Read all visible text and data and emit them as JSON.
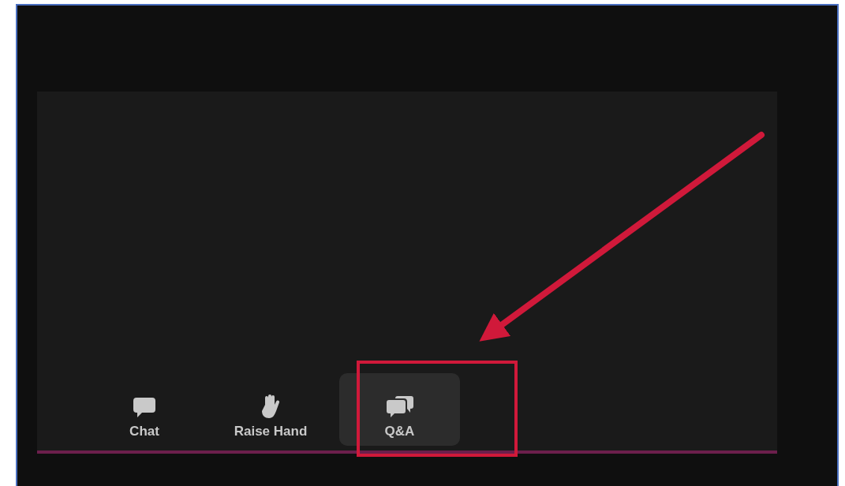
{
  "toolbar": {
    "items": [
      {
        "kind": "chat",
        "label": "Chat",
        "selected": false
      },
      {
        "kind": "hand",
        "label": "Raise Hand",
        "selected": false
      },
      {
        "kind": "qa",
        "label": "Q&A",
        "selected": true
      }
    ]
  }
}
